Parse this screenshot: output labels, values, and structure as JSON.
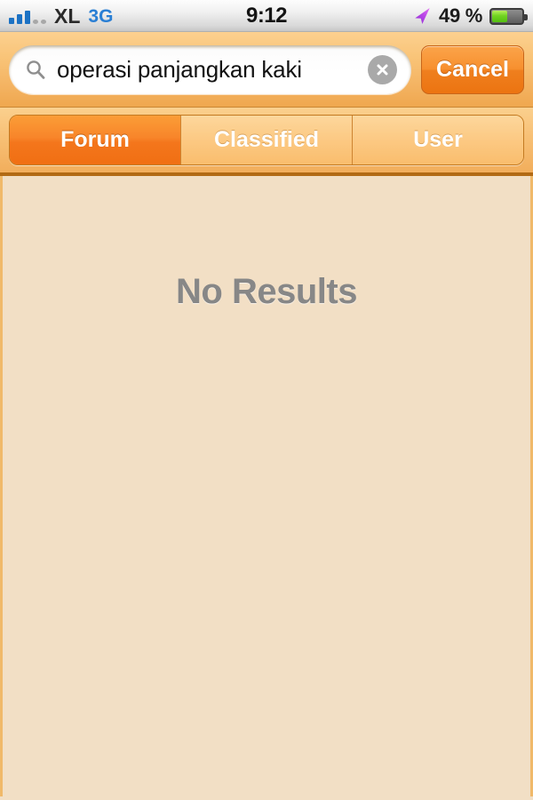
{
  "status_bar": {
    "carrier": "XL",
    "network": "3G",
    "time": "9:12",
    "battery_percent": "49 %",
    "battery_level": 49,
    "signal_bars_filled": 3,
    "signal_bars_empty": 2,
    "icons": {
      "signal": "signal-bars-icon",
      "location": "location-arrow-icon",
      "battery": "battery-icon"
    },
    "colors": {
      "signal_filled": "#1c72c4",
      "signal_empty": "#a8a8a8",
      "network_text": "#2a7fd4",
      "battery_fill": "#70d321",
      "location_arrow": "#b24de0"
    }
  },
  "search_bar": {
    "query": "operasi panjangkan kaki",
    "placeholder": "Search",
    "search_icon": "search-icon",
    "clear_icon": "clear-circle-icon",
    "cancel_label": "Cancel",
    "accent_color": "#f07f1e"
  },
  "tabs": {
    "selected": "Forum",
    "items": [
      {
        "label": "Forum",
        "active": true
      },
      {
        "label": "Classified",
        "active": false
      },
      {
        "label": "User",
        "active": false
      }
    ],
    "active_color": "#f4761c",
    "inactive_color": "#fcc983"
  },
  "content": {
    "empty_message": "No Results",
    "background_color": "#f2dfc5",
    "text_color": "#878787"
  }
}
